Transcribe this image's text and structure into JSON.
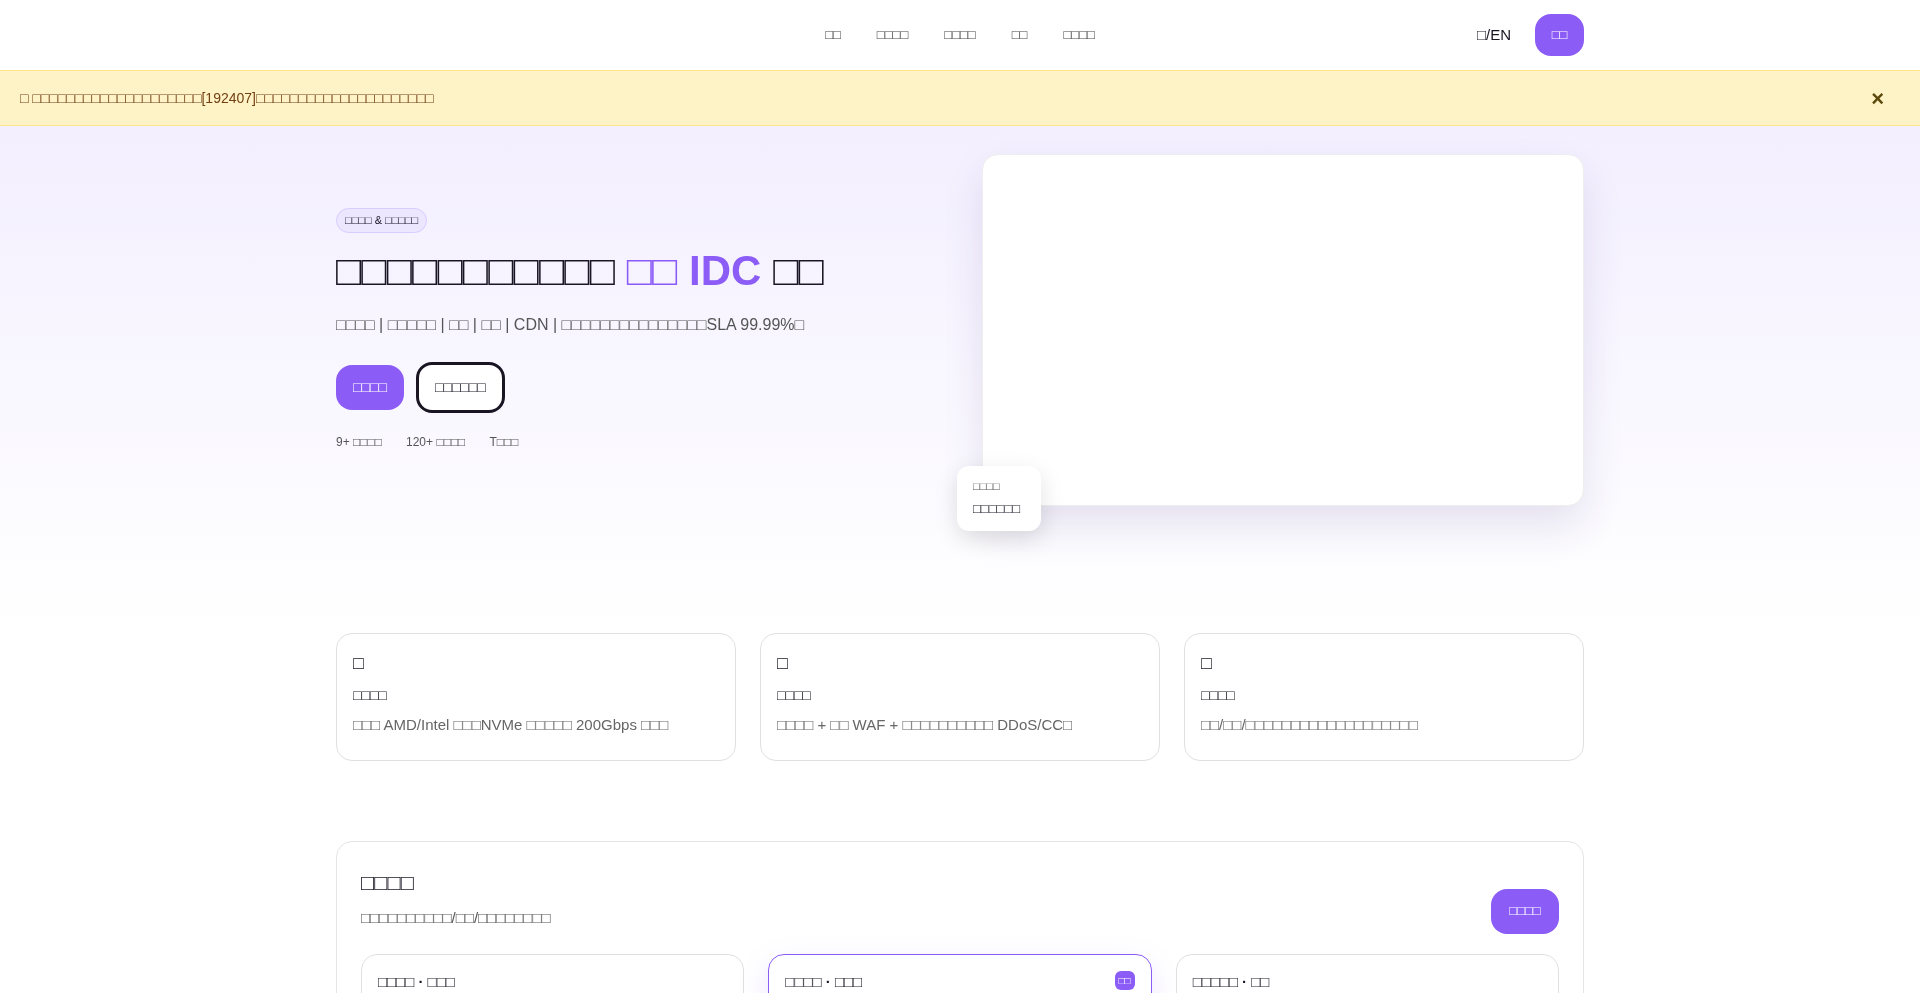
{
  "nav": {
    "links": [
      "□□",
      "□□□□",
      "□□□□",
      "□□",
      "□□□□"
    ],
    "language": "□/EN",
    "login_button": "□□"
  },
  "notice": {
    "text": "□ □□□□□□□□□□□□□□□□□□□□[192407]□□□□□□□□□□□□□□□□□□□□□",
    "close": "×"
  },
  "hero": {
    "badge": "□□□□ & □□□□□",
    "title_start": "□□□□□□□□□□□",
    "title_highlight": "□□ IDC",
    "title_end": "□□",
    "subtitle": "□□□□ | □□□□□ | □□ | □□ | CDN | □□□□□□□□□□□□□□□SLA 99.99%□",
    "primary_button": "□□□□",
    "secondary_button": "□□□□□□",
    "stats": [
      "9+ □□□□",
      "120+ □□□□",
      "T□□□"
    ],
    "floating_card": {
      "label": "□□□□",
      "value": "□□□□□□"
    }
  },
  "features": [
    {
      "icon": "□",
      "title": "□□□□",
      "description": "□□□ AMD/Intel □□□NVMe □□□□□ 200Gbps □□□"
    },
    {
      "icon": "□",
      "title": "□□□□",
      "description": "□□□□ + □□ WAF + □□□□□□□□□□ DDoS/CC□"
    },
    {
      "icon": "□",
      "title": "□□□□",
      "description": "□□/□□/□□□□□□□□□□□□□□□□□□□"
    }
  ],
  "plans": {
    "title": "□□□□",
    "subtitle": "□□□□□□□□□□/□□/□□□□□□□□",
    "button": "□□□□",
    "cards": [
      {
        "title": "□□□□ · □□□",
        "selected": false
      },
      {
        "title": "□□□□ · □□□",
        "selected": true,
        "badge": "□□"
      },
      {
        "title": "□□□□□ · □□",
        "selected": false
      }
    ]
  }
}
